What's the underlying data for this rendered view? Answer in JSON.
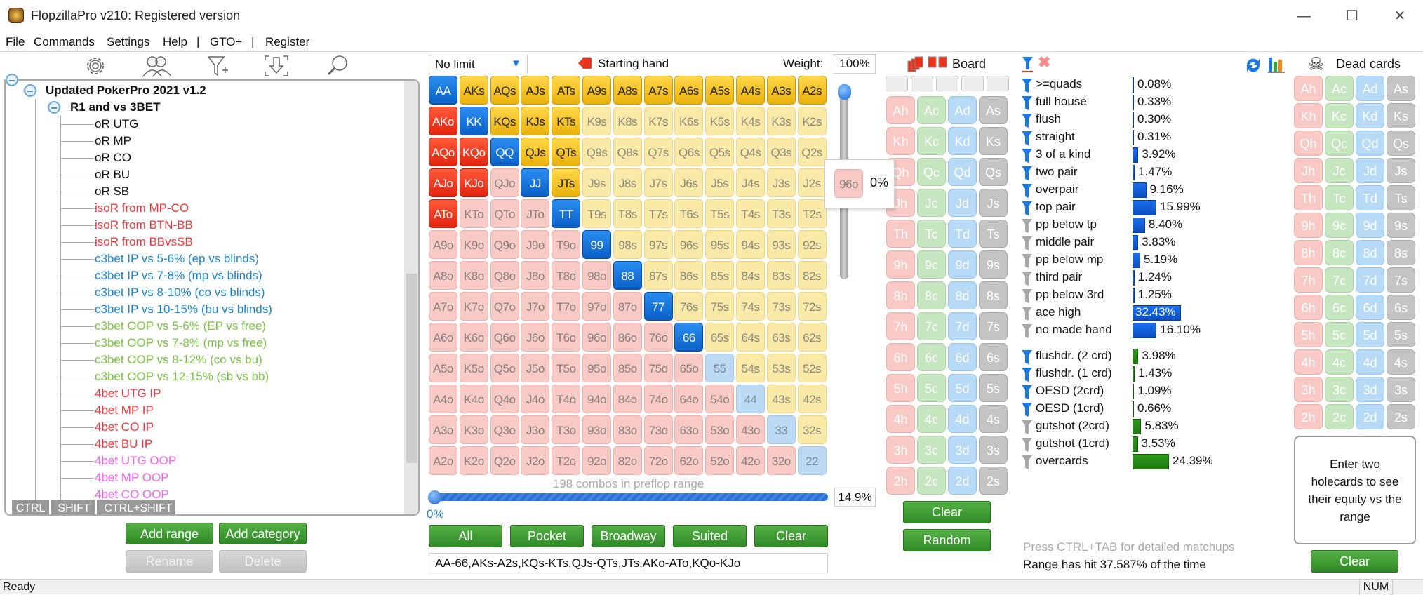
{
  "window": {
    "title": "FlopzillaPro v210: Registered version"
  },
  "menu": [
    "File",
    "Commands",
    "Settings",
    "Help",
    "|",
    "GTO+",
    "|",
    "Register"
  ],
  "tree": {
    "root": "Updated PokerPro 2021 v1.2",
    "group": "R1 and vs 3BET",
    "items": [
      {
        "label": "oR UTG",
        "color": "#111111"
      },
      {
        "label": "oR MP",
        "color": "#111111"
      },
      {
        "label": "oR CO",
        "color": "#111111"
      },
      {
        "label": "oR BU",
        "color": "#111111"
      },
      {
        "label": "oR SB",
        "color": "#111111"
      },
      {
        "label": "isoR from MP-CO",
        "color": "#e8373a"
      },
      {
        "label": "isoR from BTN-BB",
        "color": "#e8373a"
      },
      {
        "label": "isoR from BBvsSB",
        "color": "#e8373a"
      },
      {
        "label": "c3bet IP vs 5-6% (ep vs blinds)",
        "color": "#1a86d0"
      },
      {
        "label": "c3bet IP vs 7-8% (mp vs blinds)",
        "color": "#1a86d0"
      },
      {
        "label": "c3bet IP vs 8-10% (co vs blinds)",
        "color": "#1a86d0"
      },
      {
        "label": "c3bet IP vs 10-15% (bu vs blinds)",
        "color": "#1a86d0"
      },
      {
        "label": "c3bet OOP vs 5-6% (EP vs free)",
        "color": "#7ac143"
      },
      {
        "label": "c3bet OOP vs 7-8% (mp vs free)",
        "color": "#7ac143"
      },
      {
        "label": "c3bet OOP vs 8-12% (co vs bu)",
        "color": "#7ac143"
      },
      {
        "label": "c3bet OOP vs 12-15% (sb vs bb)",
        "color": "#7ac143"
      },
      {
        "label": "4bet UTG IP",
        "color": "#e8373a"
      },
      {
        "label": "4bet MP IP",
        "color": "#e8373a"
      },
      {
        "label": "4bet CO IP",
        "color": "#e8373a"
      },
      {
        "label": "4bet BU IP",
        "color": "#e8373a"
      },
      {
        "label": "4bet UTG OOP",
        "color": "#f060f0"
      },
      {
        "label": "4bet MP OOP",
        "color": "#f060f0"
      },
      {
        "label": "4bet CO OOP",
        "color": "#f060f0"
      }
    ],
    "modifier_tabs": [
      "CTRL",
      "SHIFT",
      "CTRL+SHIFT"
    ],
    "buttons": {
      "add_range": "Add range",
      "add_category": "Add category",
      "rename": "Rename",
      "delete": "Delete"
    }
  },
  "range": {
    "game_type": "No limit",
    "header": "Starting hand",
    "weight_label": "Weight:",
    "weight_value": "100%",
    "matrix": [
      [
        "AA",
        "AKs",
        "AQs",
        "AJs",
        "ATs",
        "A9s",
        "A8s",
        "A7s",
        "A6s",
        "A5s",
        "A4s",
        "A3s",
        "A2s"
      ],
      [
        "AKo",
        "KK",
        "KQs",
        "KJs",
        "KTs",
        "K9s",
        "K8s",
        "K7s",
        "K6s",
        "K5s",
        "K4s",
        "K3s",
        "K2s"
      ],
      [
        "AQo",
        "KQo",
        "QQ",
        "QJs",
        "QTs",
        "Q9s",
        "Q8s",
        "Q7s",
        "Q6s",
        "Q5s",
        "Q4s",
        "Q3s",
        "Q2s"
      ],
      [
        "AJo",
        "KJo",
        "QJo",
        "JJ",
        "JTs",
        "J9s",
        "J8s",
        "J7s",
        "J6s",
        "J5s",
        "J4s",
        "J3s",
        "J2s"
      ],
      [
        "ATo",
        "KTo",
        "QTo",
        "JTo",
        "TT",
        "T9s",
        "T8s",
        "T7s",
        "T6s",
        "T5s",
        "T4s",
        "T3s",
        "T2s"
      ],
      [
        "A9o",
        "K9o",
        "Q9o",
        "J9o",
        "T9o",
        "99",
        "98s",
        "97s",
        "96s",
        "95s",
        "94s",
        "93s",
        "92s"
      ],
      [
        "A8o",
        "K8o",
        "Q8o",
        "J8o",
        "T8o",
        "98o",
        "88",
        "87s",
        "86s",
        "85s",
        "84s",
        "83s",
        "82s"
      ],
      [
        "A7o",
        "K7o",
        "Q7o",
        "J7o",
        "T7o",
        "97o",
        "87o",
        "77",
        "76s",
        "75s",
        "74s",
        "73s",
        "72s"
      ],
      [
        "A6o",
        "K6o",
        "Q6o",
        "J6o",
        "T6o",
        "96o",
        "86o",
        "76o",
        "66",
        "65s",
        "64s",
        "63s",
        "62s"
      ],
      [
        "A5o",
        "K5o",
        "Q5o",
        "J5o",
        "T5o",
        "95o",
        "85o",
        "75o",
        "65o",
        "55",
        "54s",
        "53s",
        "52s"
      ],
      [
        "A4o",
        "K4o",
        "Q4o",
        "J4o",
        "T4o",
        "94o",
        "84o",
        "74o",
        "64o",
        "54o",
        "44",
        "43s",
        "42s"
      ],
      [
        "A3o",
        "K3o",
        "Q3o",
        "J3o",
        "T3o",
        "93o",
        "83o",
        "73o",
        "63o",
        "53o",
        "43o",
        "33",
        "32s"
      ],
      [
        "A2o",
        "K2o",
        "Q2o",
        "J2o",
        "T2o",
        "92o",
        "82o",
        "72o",
        "62o",
        "52o",
        "42o",
        "32o",
        "22"
      ]
    ],
    "selected": [
      "AA",
      "KK",
      "QQ",
      "JJ",
      "TT",
      "99",
      "88",
      "77",
      "66",
      "AKs",
      "AQs",
      "AJs",
      "ATs",
      "A9s",
      "A8s",
      "A7s",
      "A6s",
      "A5s",
      "A4s",
      "A3s",
      "A2s",
      "KQs",
      "KJs",
      "KTs",
      "QJs",
      "QTs",
      "JTs",
      "AKo",
      "AQo",
      "AJo",
      "ATo",
      "KQo",
      "KJo"
    ],
    "tooltip": {
      "hand": "96o",
      "weight": "0%"
    },
    "combos_text": "198 combos in preflop range",
    "slider_min_label": "0%",
    "slider_value": 0,
    "percent": "14.9%",
    "buttons": [
      "All",
      "Pocket",
      "Broadway",
      "Suited",
      "Clear"
    ],
    "range_text": "AA-66,AKs-A2s,KQs-KTs,QJs-QTs,JTs,AKo-ATo,KQo-KJo"
  },
  "deck": [
    [
      "Ah",
      "Ac",
      "Ad",
      "As"
    ],
    [
      "Kh",
      "Kc",
      "Kd",
      "Ks"
    ],
    [
      "Qh",
      "Qc",
      "Qd",
      "Qs"
    ],
    [
      "Jh",
      "Jc",
      "Jd",
      "Js"
    ],
    [
      "Th",
      "Tc",
      "Td",
      "Ts"
    ],
    [
      "9h",
      "9c",
      "9d",
      "9s"
    ],
    [
      "8h",
      "8c",
      "8d",
      "8s"
    ],
    [
      "7h",
      "7c",
      "7d",
      "7s"
    ],
    [
      "6h",
      "6c",
      "6d",
      "6s"
    ],
    [
      "5h",
      "5c",
      "5d",
      "5s"
    ],
    [
      "4h",
      "4c",
      "4d",
      "4s"
    ],
    [
      "3h",
      "3c",
      "3d",
      "3s"
    ],
    [
      "2h",
      "2c",
      "2d",
      "2s"
    ]
  ],
  "board": {
    "header": "Board",
    "slots": 5,
    "clear": "Clear",
    "random": "Random"
  },
  "stats": {
    "made": [
      {
        "label": ">=quads",
        "value": 0.08,
        "text": "0.08%",
        "filter": true
      },
      {
        "label": "full house",
        "value": 0.33,
        "text": "0.33%",
        "filter": true
      },
      {
        "label": "flush",
        "value": 0.3,
        "text": "0.30%",
        "filter": true
      },
      {
        "label": "straight",
        "value": 0.31,
        "text": "0.31%",
        "filter": true
      },
      {
        "label": "3 of a kind",
        "value": 3.92,
        "text": "3.92%",
        "filter": true
      },
      {
        "label": "two pair",
        "value": 1.47,
        "text": "1.47%",
        "filter": true
      },
      {
        "label": "overpair",
        "value": 9.16,
        "text": "9.16%",
        "filter": true
      },
      {
        "label": "top pair",
        "value": 15.99,
        "text": "15.99%",
        "filter": true
      },
      {
        "label": "pp below tp",
        "value": 8.4,
        "text": "8.40%",
        "filter": false
      },
      {
        "label": "middle pair",
        "value": 3.83,
        "text": "3.83%",
        "filter": false
      },
      {
        "label": "pp below mp",
        "value": 5.19,
        "text": "5.19%",
        "filter": false
      },
      {
        "label": "third pair",
        "value": 1.24,
        "text": "1.24%",
        "filter": false
      },
      {
        "label": "pp below 3rd",
        "value": 1.25,
        "text": "1.25%",
        "filter": false
      },
      {
        "label": "ace high",
        "value": 32.43,
        "text": "32.43%",
        "filter": false,
        "highlight": true
      },
      {
        "label": "no made hand",
        "value": 16.1,
        "text": "16.10%",
        "filter": false
      }
    ],
    "draws": [
      {
        "label": "flushdr. (2 crd)",
        "value": 3.98,
        "text": "3.98%",
        "filter": true
      },
      {
        "label": "flushdr. (1 crd)",
        "value": 1.43,
        "text": "1.43%",
        "filter": true
      },
      {
        "label": "OESD (2crd)",
        "value": 1.09,
        "text": "1.09%",
        "filter": true
      },
      {
        "label": "OESD (1crd)",
        "value": 0.66,
        "text": "0.66%",
        "filter": true
      },
      {
        "label": "gutshot (2crd)",
        "value": 5.83,
        "text": "5.83%",
        "filter": false
      },
      {
        "label": "gutshot (1crd)",
        "value": 3.53,
        "text": "3.53%",
        "filter": false
      },
      {
        "label": "overcards",
        "value": 24.39,
        "text": "24.39%",
        "filter": false
      }
    ],
    "hint": "Press CTRL+TAB for detailed matchups",
    "summary": "Range has hit 37.587% of the time",
    "colors": {
      "made": "#1a6ef0",
      "draws": "#2f9a1c",
      "filter_on": "#1a78e0",
      "filter_off": "#a8a8a8"
    }
  },
  "dead": {
    "header": "Dead cards",
    "equity_hint": "Enter two holecards to see their equity vs the range",
    "clear": "Clear"
  },
  "status": {
    "text": "Ready",
    "num": "NUM"
  }
}
